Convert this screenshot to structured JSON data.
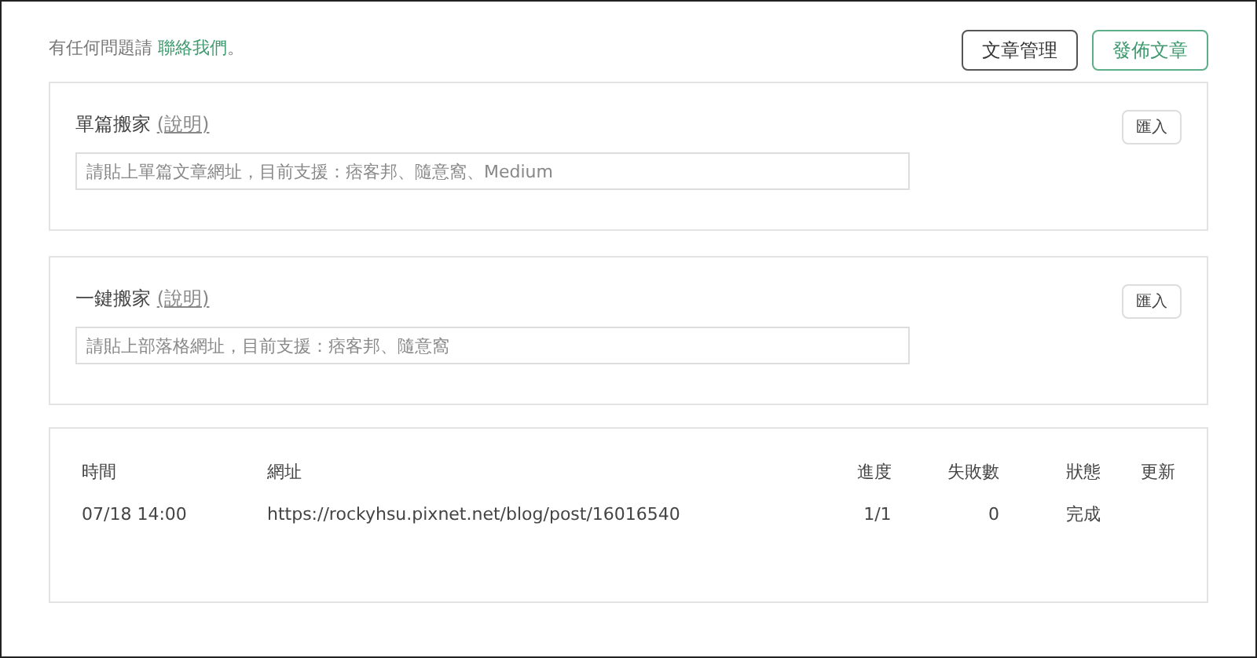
{
  "notice": {
    "text": "有任何問題請",
    "link": "聯絡我們",
    "end": "。"
  },
  "header_buttons": [
    {
      "label": "文章管理",
      "kind": "neutral"
    },
    {
      "label": "發佈文章",
      "kind": "primary"
    }
  ],
  "importers": [
    {
      "title": "單篇搬家",
      "help": "(說明)",
      "placeholder": "請貼上單篇文章網址，目前支援：痞客邦、隨意窩、Medium",
      "button": "匯入"
    },
    {
      "title": "一鍵搬家",
      "help": "(說明)",
      "placeholder": "請貼上部落格網址，目前支援：痞客邦、隨意窩",
      "button": "匯入"
    }
  ],
  "table": {
    "columns": [
      "時間",
      "網址",
      "進度",
      "失敗數",
      "狀態",
      "更新"
    ],
    "rows": [
      [
        "07/18 14:00",
        "https://rockyhsu.pixnet.net/blog/post/16016540",
        "1/1",
        "0",
        "完成"
      ]
    ]
  }
}
